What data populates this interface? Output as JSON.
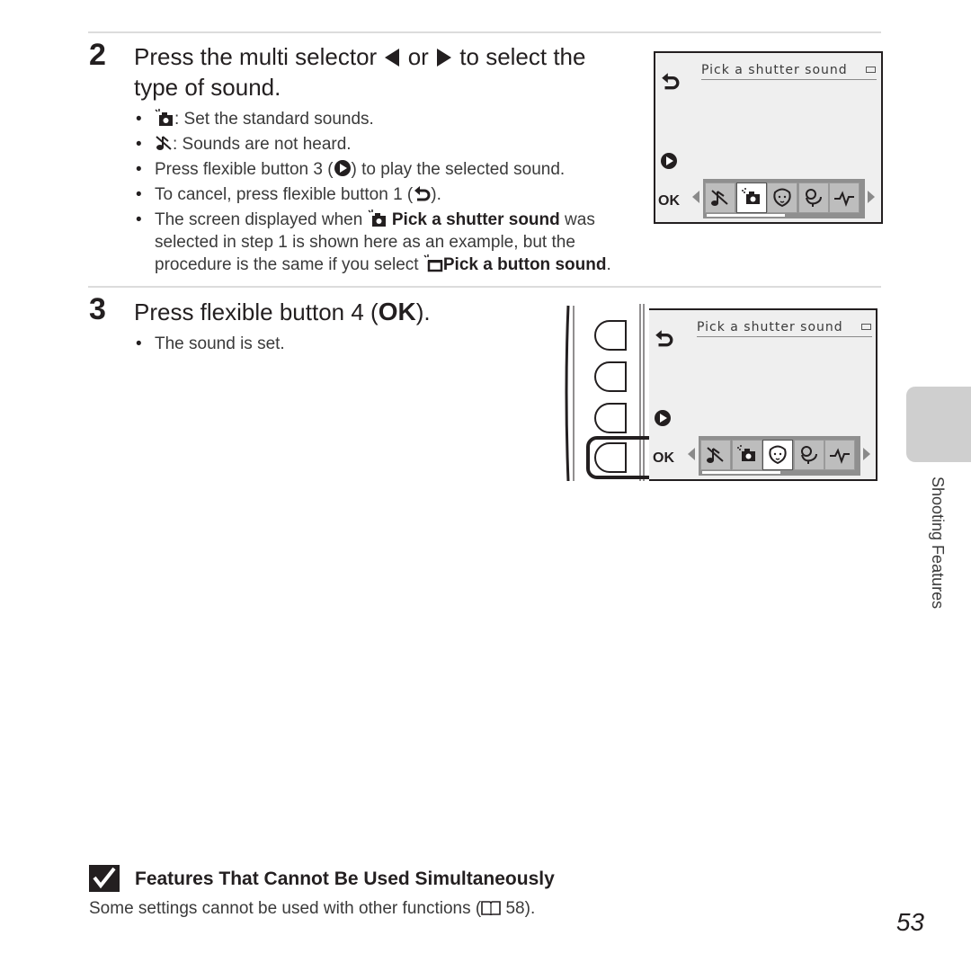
{
  "step2": {
    "number": "2",
    "title_part1": "Press the multi selector",
    "title_or": "or",
    "title_part2": "to select the",
    "title_line2": "type of sound.",
    "bullets": [
      {
        "text": ": Set the standard sounds.",
        "icon": "standard-sound-icon"
      },
      {
        "text": ": Sounds are not heard.",
        "icon": "sound-off-icon"
      },
      {
        "pre": "Press flexible button 3 (",
        "post": ") to play the selected sound.",
        "icon": "play-icon"
      },
      {
        "pre": "To cancel, press flexible button 1 (",
        "post": ").",
        "icon": "back-icon"
      }
    ],
    "note": {
      "pre": "The screen displayed when",
      "bold1": "Pick a shutter sound",
      "mid": "was",
      "line2": "selected in step 1 is shown here as an example, but the",
      "line3_pre": "procedure is the same if you select",
      "bold2": "Pick a button sound",
      "end": "."
    }
  },
  "step3": {
    "number": "3",
    "title_pre": "Press flexible button 4 (",
    "title_ok": "OK",
    "title_post": ").",
    "bullets": [
      "The sound is set."
    ]
  },
  "screen": {
    "title": "Pick a shutter sound",
    "ok_label": "OK",
    "options": [
      "sound-off-icon",
      "standard-sound-icon",
      "dog-icon",
      "bird-icon",
      "beep-icon"
    ],
    "selected_step2": 1,
    "selected_step3": 2
  },
  "side_tab": {
    "label": "Shooting Features"
  },
  "note": {
    "title": "Features That Cannot Be Used Simultaneously",
    "body_pre": "Some settings cannot be used with other functions (",
    "body_ref": "58",
    "body_post": ")."
  },
  "page_number": "53"
}
